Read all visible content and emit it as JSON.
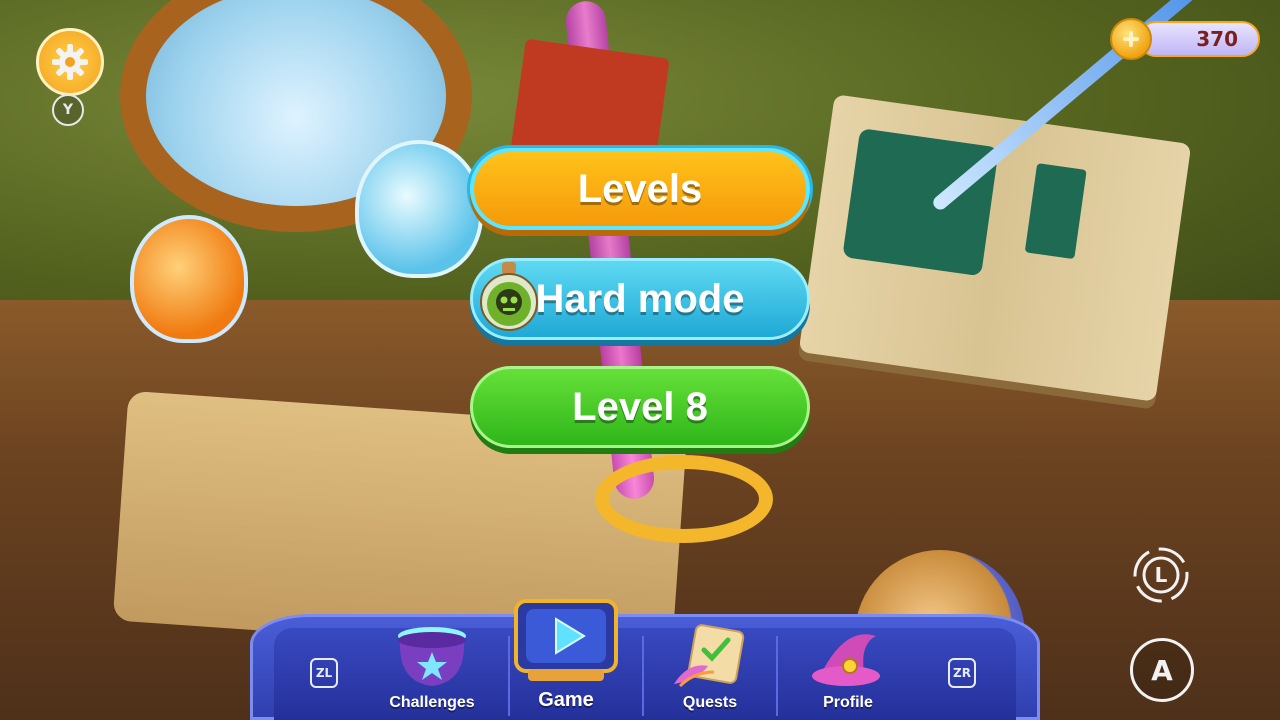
{
  "hud": {
    "settings_key": "Y",
    "coins": "370"
  },
  "menu": {
    "levels_label": "Levels",
    "hard_mode_label": "Hard mode",
    "current_level_label": "Level 8"
  },
  "nav": {
    "left_key": "ZL",
    "right_key": "ZR",
    "items": [
      {
        "label": "Challenges",
        "icon": "cauldron-icon"
      },
      {
        "label": "Game",
        "icon": "play-icon",
        "active": true
      },
      {
        "label": "Quests",
        "icon": "scroll-quill-icon"
      },
      {
        "label": "Profile",
        "icon": "wizard-hat-icon"
      }
    ]
  },
  "controls": {
    "stick_label": "L",
    "confirm_label": "A"
  },
  "colors": {
    "levels": "#f7a80f",
    "hard_mode": "#2fb5dd",
    "level8": "#3cc321",
    "nav": "#3346b8",
    "coin": "#f0a412"
  }
}
